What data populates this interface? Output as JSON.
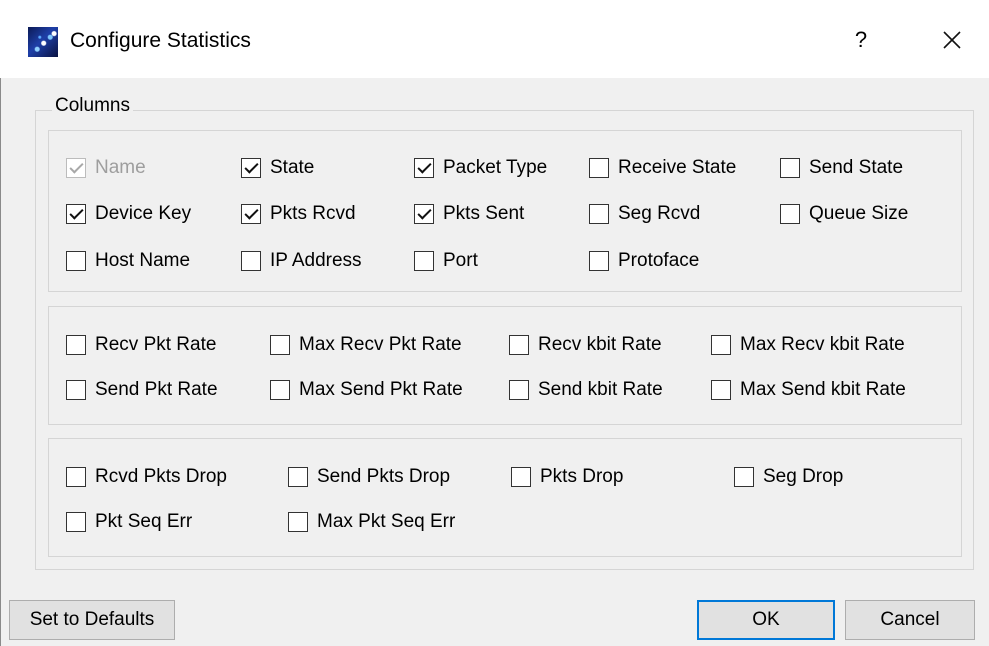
{
  "dialog": {
    "title": "Configure Statistics",
    "help_label": "?",
    "close_icon": "close-icon",
    "app_icon": "app-icon"
  },
  "group": {
    "title": "Columns"
  },
  "panels": [
    {
      "items": [
        {
          "label": "Name",
          "checked": true,
          "disabled": true
        },
        {
          "label": "State",
          "checked": true
        },
        {
          "label": "Packet Type",
          "checked": true
        },
        {
          "label": "Receive State",
          "checked": false
        },
        {
          "label": "Send State",
          "checked": false
        },
        {
          "label": "Device Key",
          "checked": true
        },
        {
          "label": "Pkts Rcvd",
          "checked": true
        },
        {
          "label": "Pkts Sent",
          "checked": true
        },
        {
          "label": "Seg Rcvd",
          "checked": false
        },
        {
          "label": "Queue Size",
          "checked": false
        },
        {
          "label": "Host Name",
          "checked": false
        },
        {
          "label": "IP Address",
          "checked": false
        },
        {
          "label": "Port",
          "checked": false
        },
        {
          "label": "Protoface",
          "checked": false
        }
      ]
    },
    {
      "items": [
        {
          "label": "Recv Pkt Rate",
          "checked": false
        },
        {
          "label": "Max Recv Pkt Rate",
          "checked": false
        },
        {
          "label": "Recv kbit Rate",
          "checked": false
        },
        {
          "label": "Max Recv kbit Rate",
          "checked": false
        },
        {
          "label": "Send Pkt Rate",
          "checked": false
        },
        {
          "label": "Max Send Pkt Rate",
          "checked": false
        },
        {
          "label": "Send kbit Rate",
          "checked": false
        },
        {
          "label": "Max Send kbit Rate",
          "checked": false
        }
      ]
    },
    {
      "items": [
        {
          "label": "Rcvd Pkts Drop",
          "checked": false
        },
        {
          "label": "Send Pkts Drop",
          "checked": false
        },
        {
          "label": "Pkts Drop",
          "checked": false
        },
        {
          "label": "Seg Drop",
          "checked": false
        },
        {
          "label": "Pkt Seq Err",
          "checked": false
        },
        {
          "label": "Max Pkt Seq Err",
          "checked": false
        }
      ]
    }
  ],
  "buttons": {
    "defaults": "Set to Defaults",
    "ok": "OK",
    "cancel": "Cancel"
  }
}
